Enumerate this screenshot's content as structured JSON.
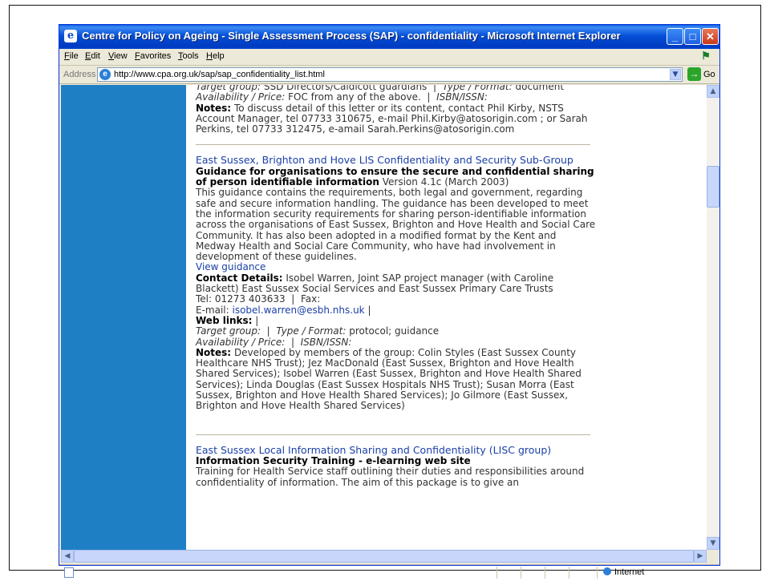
{
  "window": {
    "title": "Centre for Policy on Ageing - Single Assessment Process (SAP) - confidentiality - Microsoft Internet Explorer",
    "controls": {
      "minimize": "_",
      "maximize": "□",
      "close": "✕"
    }
  },
  "menu": [
    "File",
    "Edit",
    "View",
    "Favorites",
    "Tools",
    "Help"
  ],
  "address": {
    "label": "Address",
    "url": "http://www.cpa.org.uk/sap/sap_confidentiality_list.html",
    "go_label": "Go"
  },
  "status": {
    "zone": "Internet"
  },
  "entry1": {
    "target_label": "Target group:",
    "target_value": "SSD Directors/Caldicott guardians",
    "format_label": "Type / Format:",
    "format_value": "document",
    "avail_label": "Availability / Price:",
    "avail_value": "FOC from any of the above.",
    "isbn_label": "ISBN/ISSN:",
    "notes_label": "Notes:",
    "notes_value": "To discuss detail of this letter or its content, contact Phil Kirby, NSTS Account Manager, tel 07733 310675, e-mail Phil.Kirby@atosorigin.com ; or Sarah Perkins, tel 07733 312475, e-amail Sarah.Perkins@atosorigin.com"
  },
  "entry2": {
    "org": "East Sussex, Brighton and Hove LIS Confidentiality and Security Sub-Group",
    "title": "Guidance for organisations to ensure the secure and confidential sharing of person identifiable information",
    "version": "Version 4.1c (March 2003)",
    "description": "This guidance contains the requirements, both legal and government, regarding safe and secure information handling. The guidance has been developed to meet the information security requirements for sharing person-identifiable information across the organisations of East Sussex, Brighton and Hove Health and Social Care Community. It has also been adopted in a modified format by the Kent and Medway Health and Social Care Community, who have had involvement in development of these guidelines.",
    "view_link": "View guidance",
    "contact_label": "Contact Details:",
    "contact_value": "Isobel Warren, Joint SAP project manager (with Caroline Blackett) East Sussex Social Services and East Sussex Primary Care Trusts",
    "tel": "Tel: 01273 403633",
    "fax": "Fax:",
    "email_label": "E-mail:",
    "email": "isobel.warren@esbh.nhs.uk",
    "weblinks_label": "Web links:",
    "target_label": "Target group:",
    "format_label": "Type / Format:",
    "format_value": "protocol; guidance",
    "avail_label": "Availability / Price:",
    "isbn_label": "ISBN/ISSN:",
    "notes_label": "Notes:",
    "notes_value": "Developed by members of the group: Colin Styles (East Sussex County Healthcare NHS Trust); Jez MacDonald (East Sussex, Brighton and Hove Health Shared Services); Isobel Warren (East Sussex, Brighton and Hove Health Shared Services); Linda Douglas (East Sussex Hospitals NHS Trust); Susan Morra (East Sussex, Brighton and Hove Health Shared Services); Jo Gilmore (East Sussex, Brighton and Hove Health Shared Services)"
  },
  "entry3": {
    "org": "East Sussex Local Information Sharing and Confidentiality (LISC group)",
    "title": "Information Security Training - e-learning web site",
    "description": "Training for Health Service staff outlining their duties and responsibilities around confidentiality of information. The aim of this package is to give an"
  },
  "icons": {
    "ie": "ie-icon",
    "go": "go-arrow-icon",
    "globe": "globe-icon",
    "xp": "windows-flag-icon"
  }
}
